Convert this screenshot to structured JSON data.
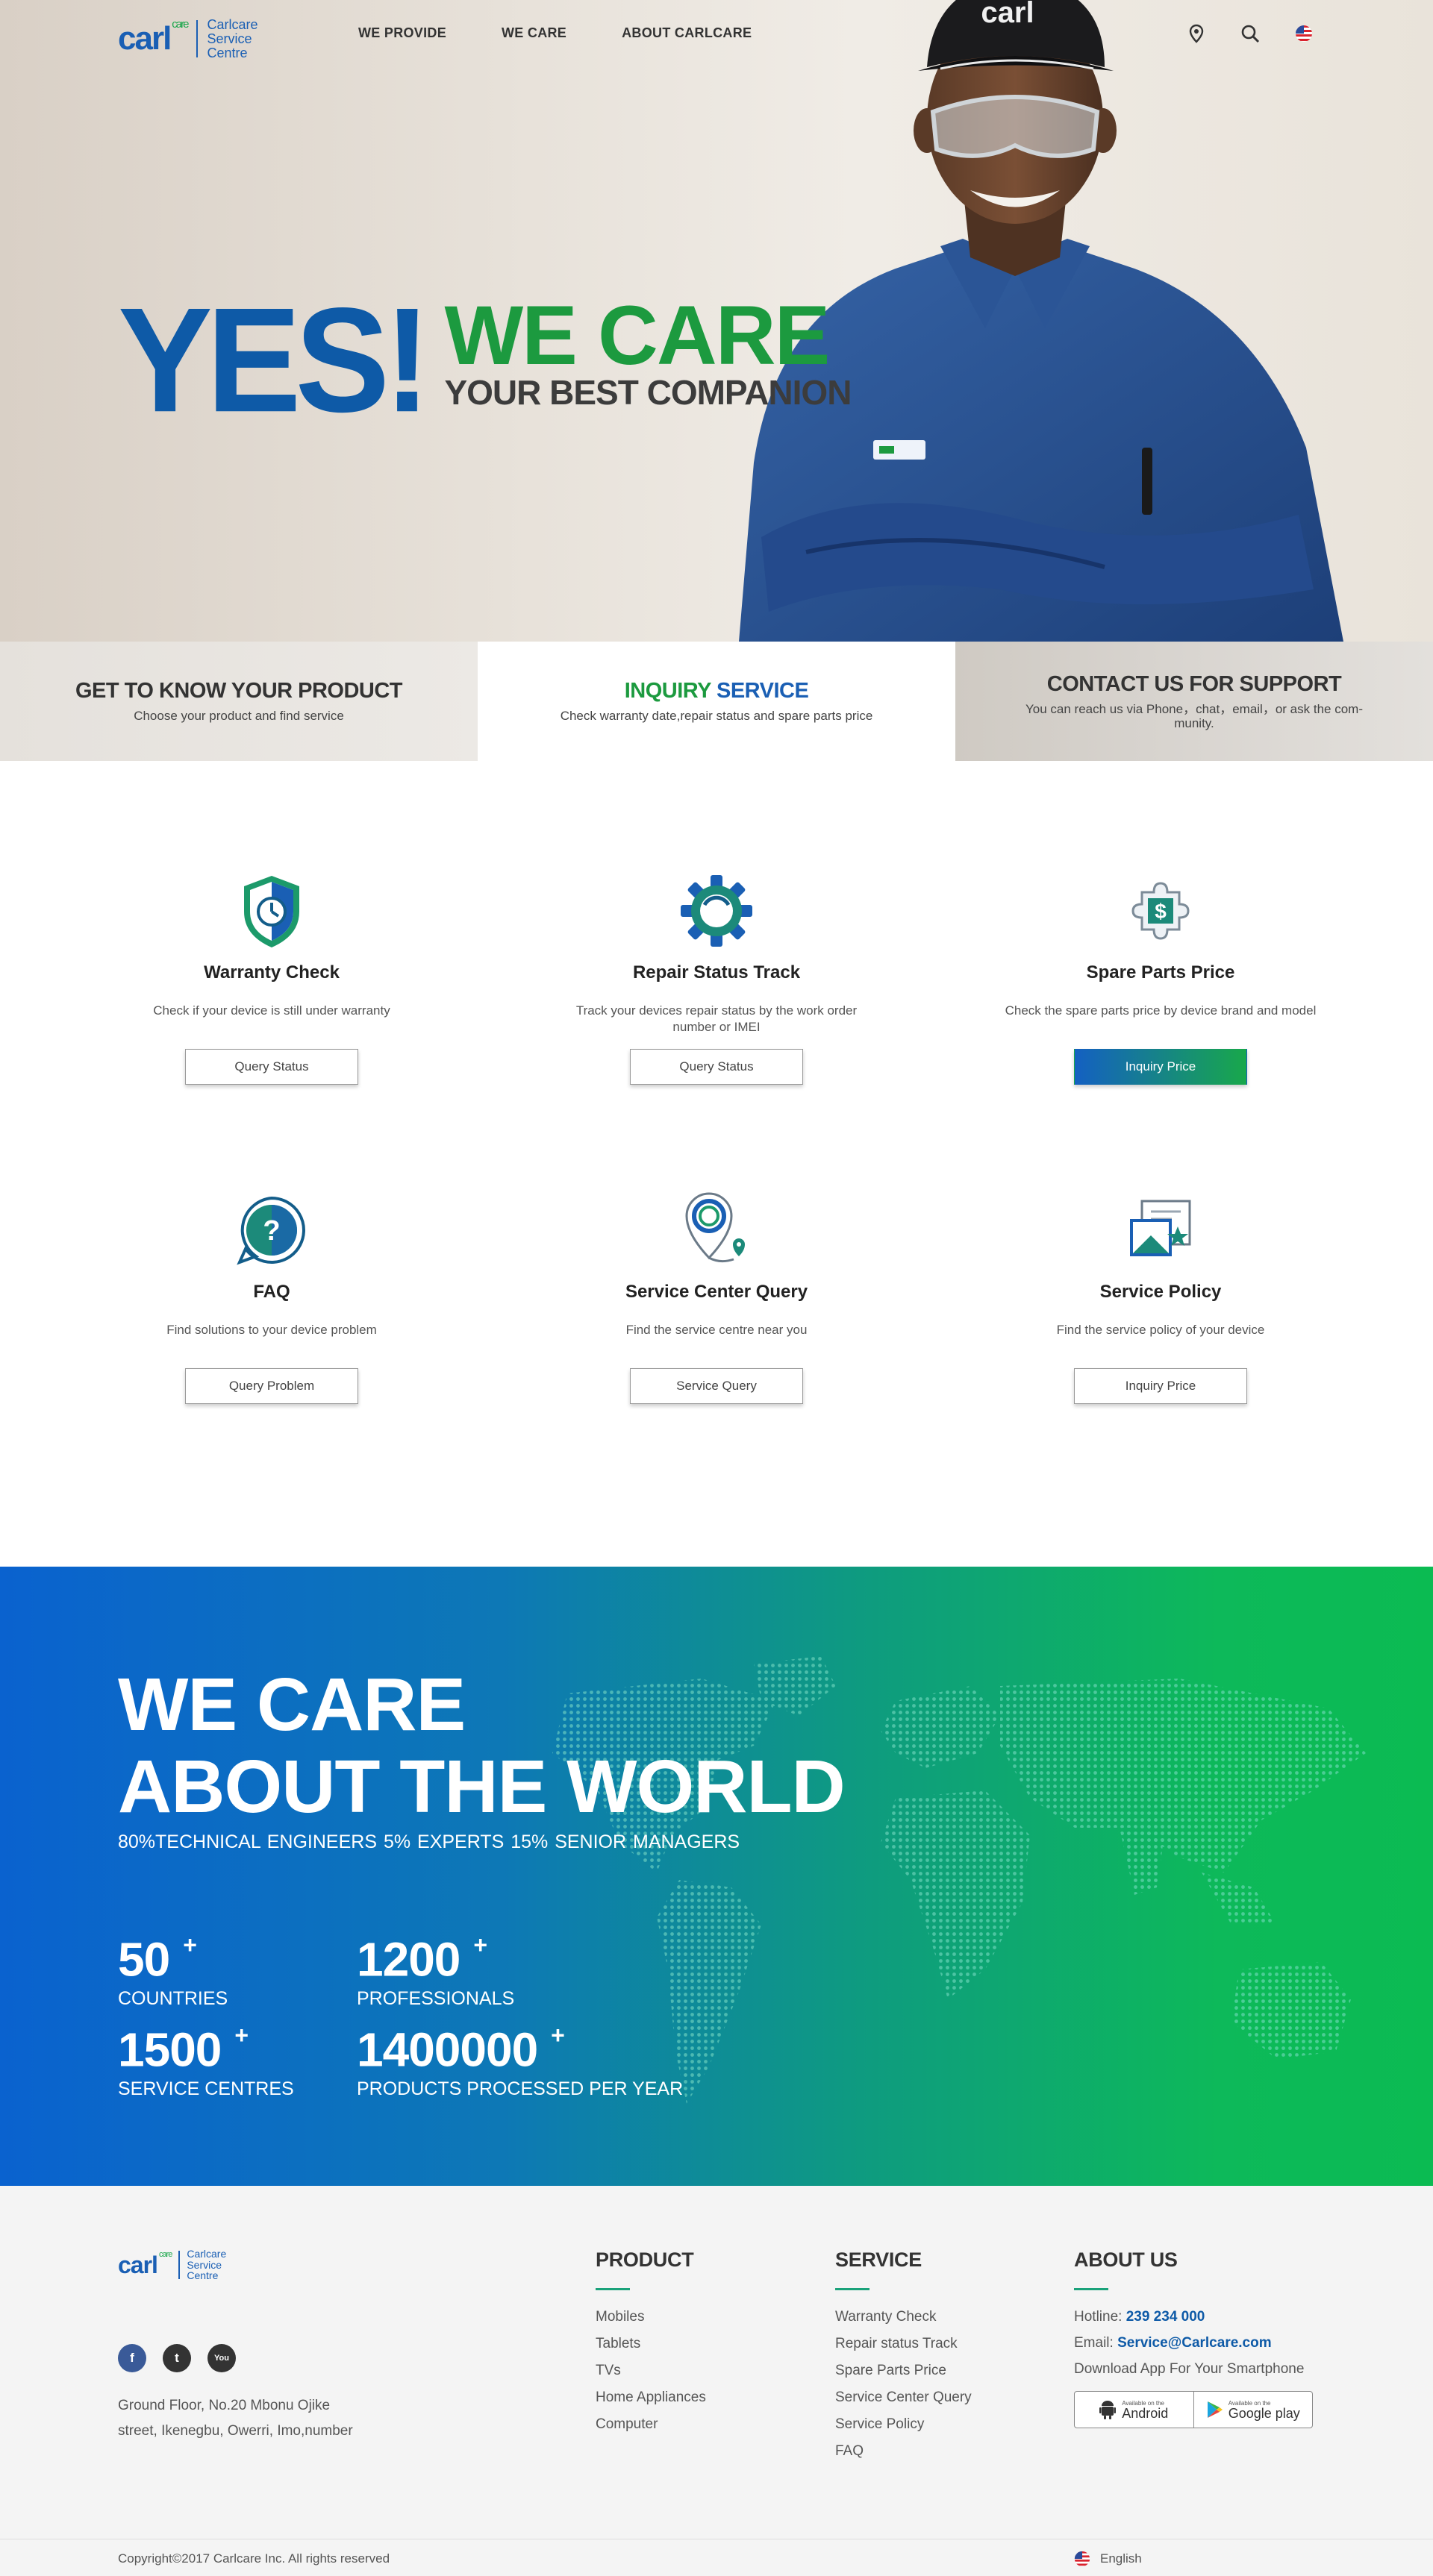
{
  "brand": {
    "mark": "carl",
    "mark_sup": "care",
    "name_lines": [
      "Carlcare",
      "Service",
      "Centre"
    ],
    "colors": {
      "blue": "#0e5aa7",
      "green": "#1c9a3f",
      "accent_gradient": [
        "#0a62cf",
        "#0bbb52"
      ]
    }
  },
  "nav": {
    "items": [
      "WE PROVIDE",
      "WE CARE",
      "ABOUT CARLCARE"
    ],
    "icons": [
      "location-pin-icon",
      "search-icon",
      "us-flag-icon"
    ]
  },
  "hero": {
    "yes": "YES!",
    "we_care": "WE CARE",
    "companion": "YOUR BEST COMPANION",
    "cap_logo": "carl"
  },
  "tabs": [
    {
      "title": "GET TO KNOW YOUR PRODUCT",
      "desc": "Choose your product and find  service"
    },
    {
      "title_green": "INQUIRY ",
      "title_blue": "SERVICE",
      "desc": "Check warranty date,repair status and spare parts price"
    },
    {
      "title": "CONTACT US FOR SUPPORT",
      "desc": "You can reach us via Phone，chat，email，or ask the com-munity."
    }
  ],
  "services": [
    {
      "title": "Warranty Check",
      "desc": "Check if your device is still under warranty",
      "button": "Query Status",
      "icon": "shield-clock-icon"
    },
    {
      "title": "Repair Status Track",
      "desc": "Track your devices repair status by the work order number or IMEI",
      "button": "Query Status",
      "icon": "gear-icon"
    },
    {
      "title": "Spare Parts Price",
      "desc": "Check the spare parts price by device brand and model",
      "button": "Inquiry Price",
      "icon": "dollar-puzzle-icon"
    },
    {
      "title": "FAQ",
      "desc": "Find solutions to your device problem",
      "button": "Query Problem",
      "icon": "question-bubble-icon"
    },
    {
      "title": "Service Center Query",
      "desc": "Find the service centre near you",
      "button": "Service Query",
      "icon": "map-pin-icon"
    },
    {
      "title": "Service Policy",
      "desc": "Find the service policy of your device",
      "button": "Inquiry Price",
      "icon": "policy-document-icon"
    }
  ],
  "world": {
    "title_line1": "WE CARE",
    "title_line2": "ABOUT THE WORLD",
    "subtitle": "80%TECHNICAL ENGINEERS   5% EXPERTS   15% SENIOR MANAGERS",
    "stats": [
      {
        "num": "50",
        "plus": "+",
        "label": "COUNTRIES"
      },
      {
        "num": "1200",
        "plus": "+",
        "label": "PROFESSIONALS"
      },
      {
        "num": "1500",
        "plus": "+",
        "label": "SERVICE CENTRES"
      },
      {
        "num": "1400000",
        "plus": "+",
        "label": "PRODUCTS PROCESSED PER YEAR"
      }
    ]
  },
  "footer": {
    "social": [
      "f",
      "t",
      "You"
    ],
    "social_icons": [
      "facebook-icon",
      "twitter-icon",
      "youtube-icon"
    ],
    "address_lines": [
      "Ground Floor, No.20 Mbonu Ojike",
      "street, Ikenegbu, Owerri, Imo,number"
    ],
    "product": {
      "title": "PRODUCT",
      "items": [
        "Mobiles",
        "Tablets",
        "TVs",
        "Home Appliances",
        "Computer"
      ]
    },
    "service": {
      "title": "SERVICE",
      "items": [
        "Warranty Check",
        "Repair status Track",
        "Spare Parts Price",
        "Service Center Query",
        "Service Policy",
        "FAQ"
      ]
    },
    "about": {
      "title": "ABOUT US",
      "hotline_label": "Hotline: ",
      "hotline": "239 234 000",
      "email_label": "Email: ",
      "email": "Service@Carlcare.com",
      "download": "Download App For Your Smartphone",
      "android_small": "Available on the",
      "android_big": "Android",
      "gplay_small": "Available on the",
      "gplay_big": "Google play"
    },
    "copyright": "Copyright©2017   Carlcare Inc. All rights reserved",
    "language": "English"
  }
}
